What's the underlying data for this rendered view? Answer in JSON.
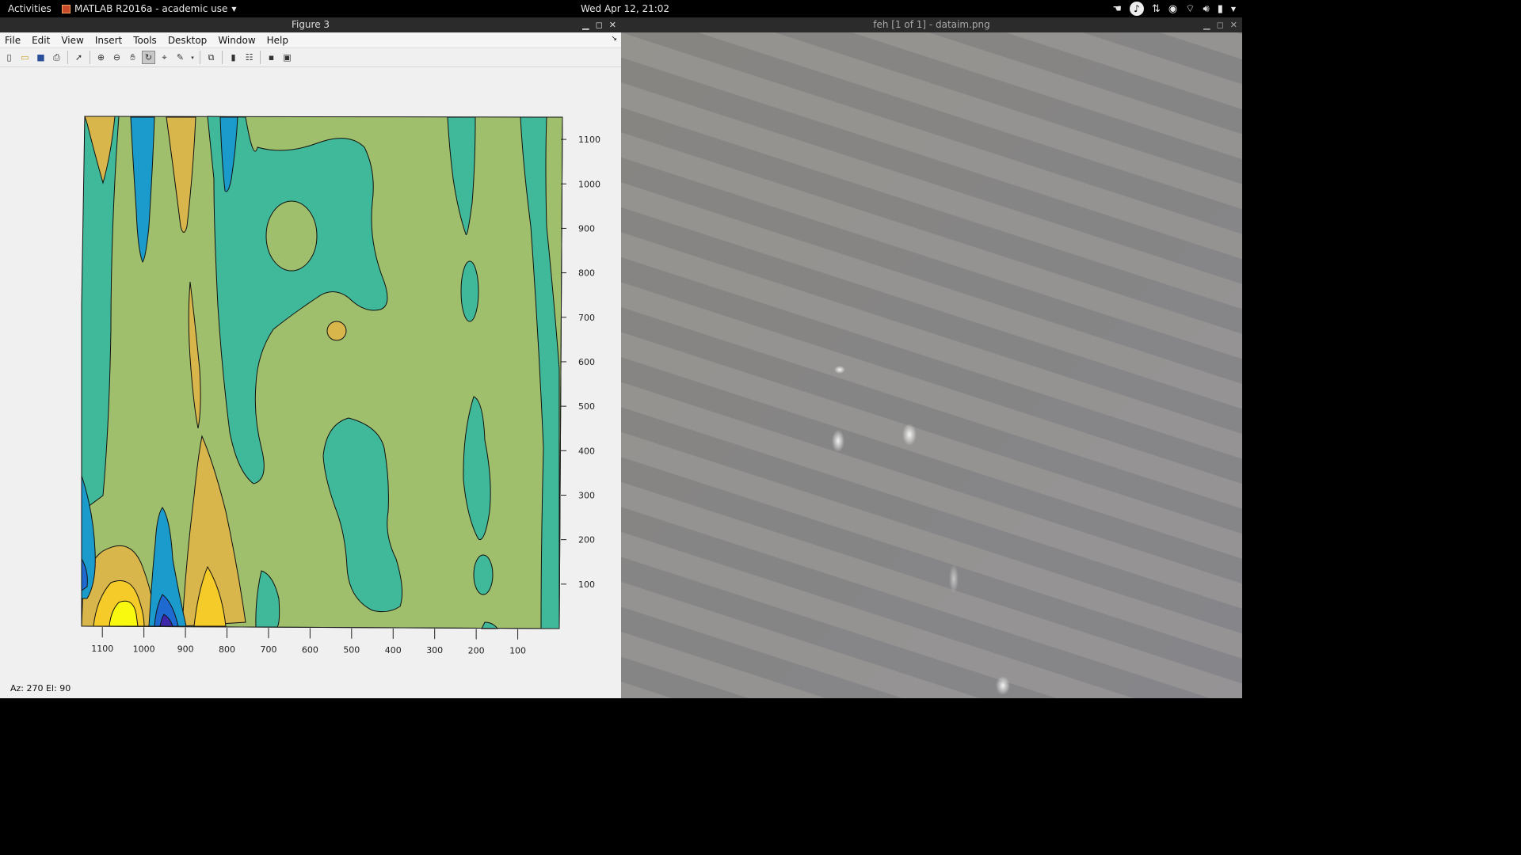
{
  "topbar": {
    "activities": "Activities",
    "app_name": "MATLAB R2016a - academic use",
    "clock": "Wed Apr 12, 21:02",
    "tray_icons": [
      "hand-icon",
      "music-icon",
      "transfer-icon",
      "record-icon",
      "wifi-icon",
      "volume-icon",
      "battery-icon",
      "chevron-down-icon"
    ]
  },
  "figure_window": {
    "title": "Figure 3",
    "menu": [
      "File",
      "Edit",
      "View",
      "Insert",
      "Tools",
      "Desktop",
      "Window",
      "Help"
    ],
    "toolbar_icons": [
      "new-figure-icon",
      "open-icon",
      "save-icon",
      "print-icon",
      "edit-plot-icon",
      "zoom-in-icon",
      "zoom-out-icon",
      "pan-icon",
      "rotate-3d-icon",
      "data-cursor-icon",
      "brush-icon",
      "link-icon",
      "colorbar-icon",
      "legend-icon",
      "hide-tools-icon",
      "show-tools-icon"
    ],
    "status": "Az:  270 El:   90"
  },
  "feh_window": {
    "title": "feh [1 of 1] - dataim.png"
  },
  "chart_data": {
    "type": "heatmap",
    "subtype": "filled contour, view Az 270 El 90",
    "x_ticks": [
      "1100",
      "1000",
      "900",
      "800",
      "700",
      "600",
      "500",
      "400",
      "300",
      "200",
      "100"
    ],
    "y_ticks": [
      "1100",
      "1000",
      "900",
      "800",
      "700",
      "600",
      "500",
      "400",
      "300",
      "200",
      "100"
    ],
    "x_range": [
      1150,
      0
    ],
    "y_range": [
      0,
      1150
    ],
    "colormap": [
      "#3d26a8",
      "#1f6ad1",
      "#1a9bcb",
      "#40b89a",
      "#9fbf6c",
      "#d9b64b",
      "#f5cb2a",
      "#f9f90f"
    ],
    "background_level_color": "#9fbf6c",
    "title": "",
    "xlabel": "",
    "ylabel": ""
  }
}
